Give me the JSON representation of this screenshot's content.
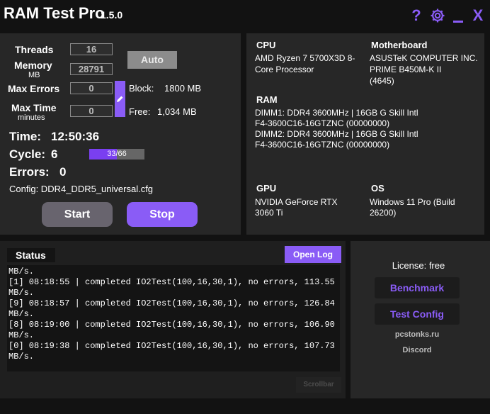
{
  "app": {
    "title": "RAM Test Pro",
    "version": "1.5.0",
    "help_glyph": "?",
    "close_glyph": "X"
  },
  "colors": {
    "accent": "#8a5cf6",
    "panel": "#272727",
    "background": "#121212"
  },
  "settings": {
    "threads_label": "Threads",
    "threads_value": "16",
    "memory_label": "Memory",
    "memory_unit": "MB",
    "memory_value": "28791",
    "auto_label": "Auto",
    "max_errors_label": "Max Errors",
    "max_errors_value": "0",
    "max_time_label": "Max Time",
    "max_time_unit": "minutes",
    "max_time_value": "0",
    "block_label": "Block:",
    "block_value": "1800 MB",
    "free_label": "Free:",
    "free_value": "1,034 MB"
  },
  "run": {
    "time_label": "Time:",
    "time_value": "12:50:36",
    "cycle_label": "Cycle:",
    "cycle_value": "6",
    "progress_text": "33/66",
    "progress_fraction": 0.5,
    "errors_label": "Errors:",
    "errors_value": "0",
    "config_text": "Config: DDR4_DDR5_universal.cfg",
    "start_label": "Start",
    "stop_label": "Stop"
  },
  "info": {
    "cpu_title": "CPU",
    "cpu_line1": "AMD Ryzen 7 5700X3D 8-",
    "cpu_line2": "Core Processor",
    "mb_title": "Motherboard",
    "mb_line1": "ASUSTeK COMPUTER INC.",
    "mb_line2": "PRIME B450M-K II",
    "mb_line3": "(4645)",
    "ram_title": "RAM",
    "ram_line1": "DIMM1: DDR4 3600MHz | 16GB G Skill Intl",
    "ram_line2": "F4-3600C16-16GTZNC (00000000)",
    "ram_line3": "DIMM2: DDR4 3600MHz | 16GB G Skill Intl",
    "ram_line4": "F4-3600C16-16GTZNC (00000000)",
    "gpu_title": "GPU",
    "gpu_line1": "NVIDIA GeForce RTX",
    "gpu_line2": "3060 Ti",
    "os_title": "OS",
    "os_line1": "Windows 11 Pro (Build",
    "os_line2": "26200)"
  },
  "status": {
    "tab_label": "Status",
    "open_log_label": "Open Log",
    "scrollbar_label": "Scrollbar",
    "lines": [
      "MB/s.",
      "[1] 08:18:55 | completed IO2Test(100,16,30,1), no errors, 113.55",
      "MB/s.",
      "[9] 08:18:57 | completed IO2Test(100,16,30,1), no errors, 126.84",
      "MB/s.",
      "[8] 08:19:00 | completed IO2Test(100,16,30,1), no errors, 106.90",
      "MB/s.",
      "[0] 08:19:38 | completed IO2Test(100,16,30,1), no errors, 107.73",
      "MB/s."
    ]
  },
  "side": {
    "license_text": "License: free",
    "benchmark_label": "Benchmark",
    "test_config_label": "Test Config",
    "site_link": "pcstonks.ru",
    "discord_link": "Discord"
  }
}
